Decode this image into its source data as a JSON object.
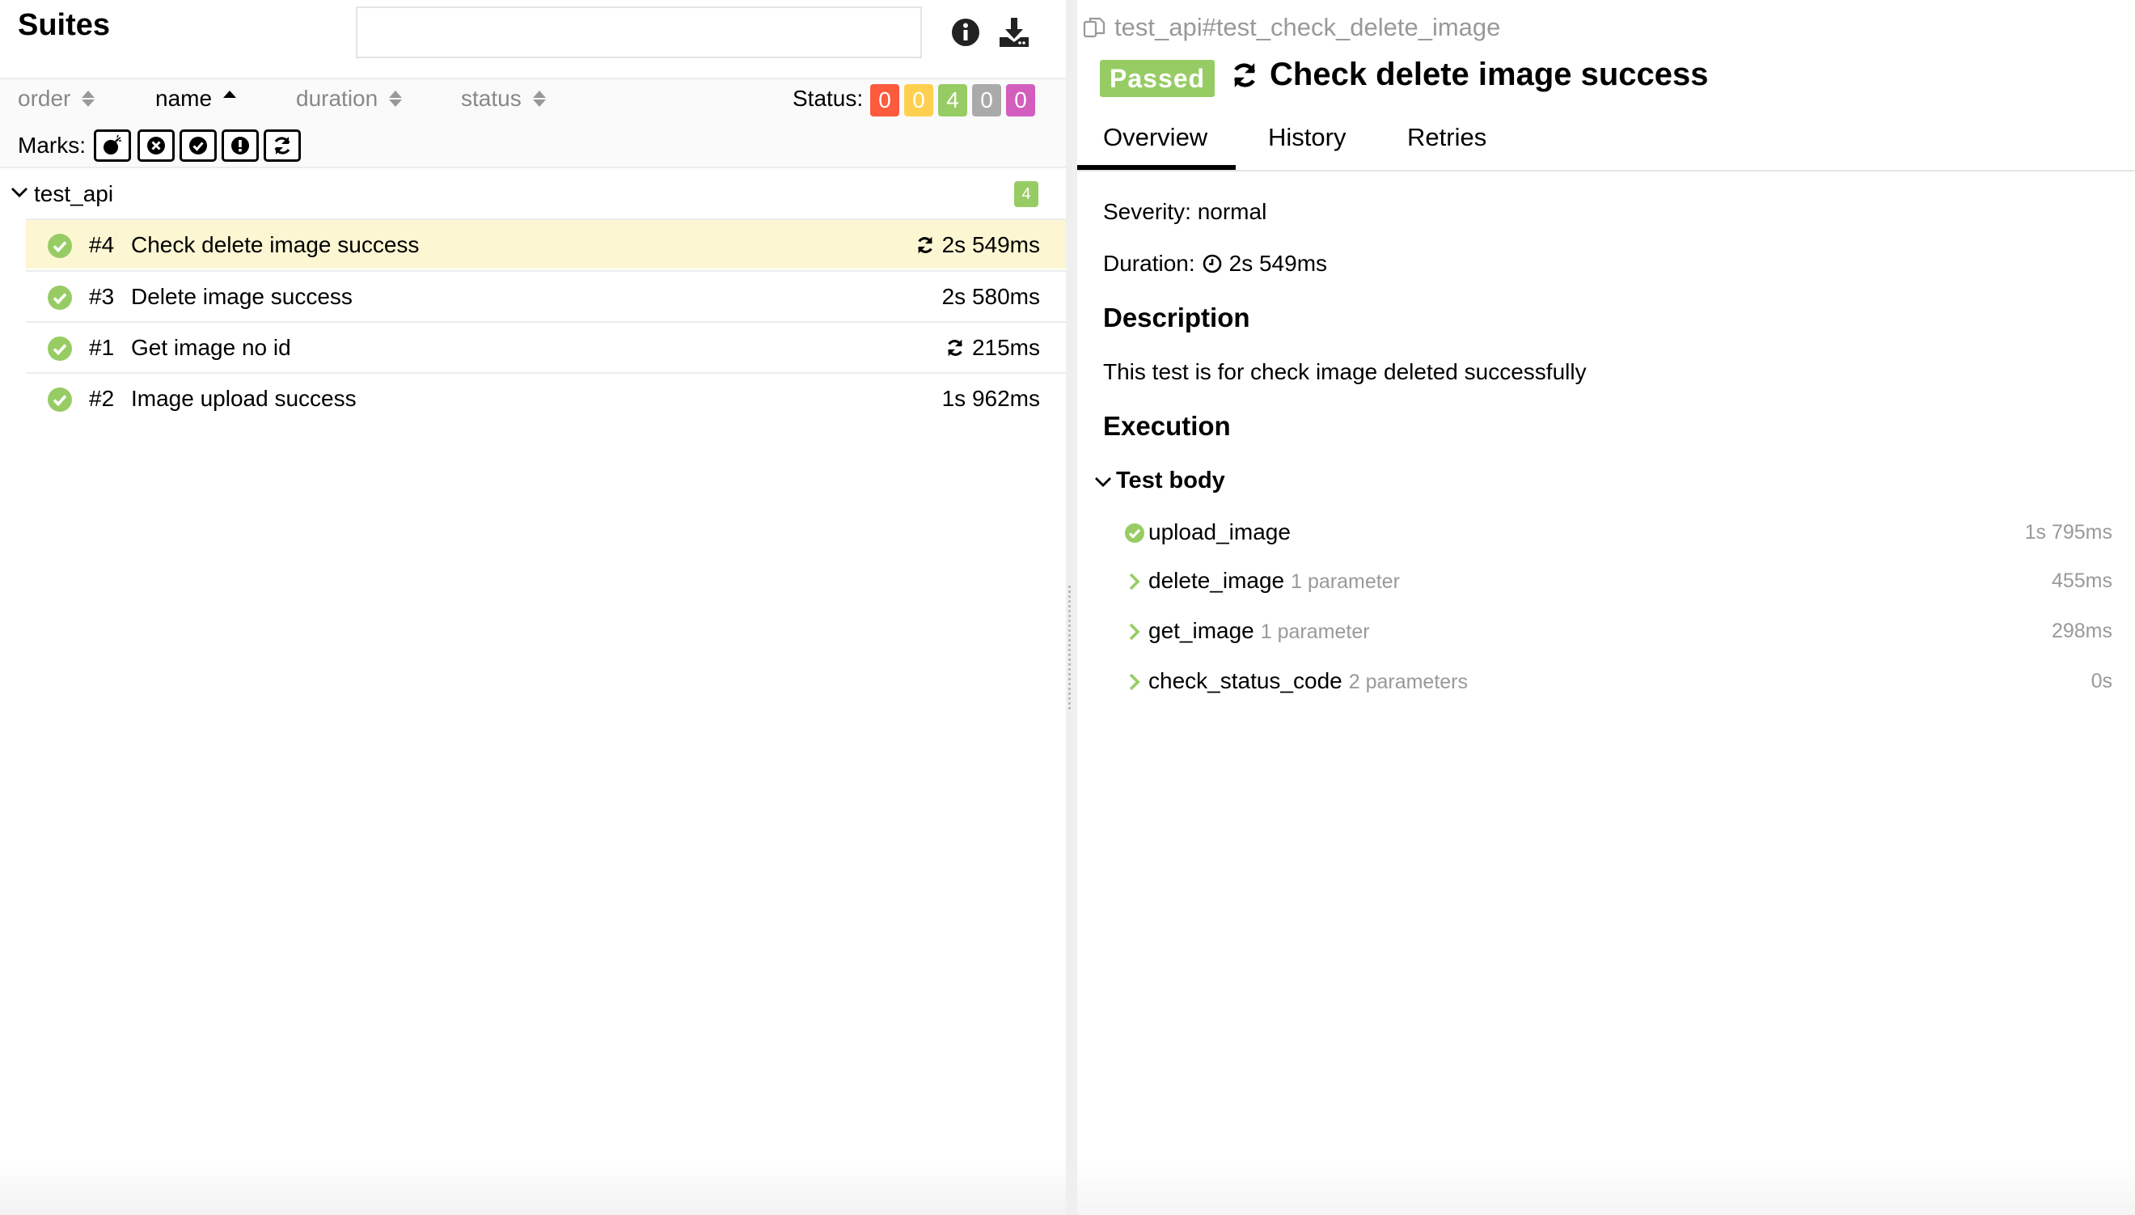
{
  "left": {
    "title": "Suites",
    "search": {
      "value": "",
      "placeholder": ""
    },
    "sorters": [
      {
        "label": "order",
        "active": false
      },
      {
        "label": "name",
        "active": true
      },
      {
        "label": "duration",
        "active": false
      },
      {
        "label": "status",
        "active": false
      }
    ],
    "status_label": "Status:",
    "status_counts": [
      {
        "name": "failed",
        "count": "0",
        "color": "#fd5a3e"
      },
      {
        "name": "broken",
        "count": "0",
        "color": "#ffd050"
      },
      {
        "name": "passed",
        "count": "4",
        "color": "#97cc64"
      },
      {
        "name": "skipped",
        "count": "0",
        "color": "#aaaaaa"
      },
      {
        "name": "unknown",
        "count": "0",
        "color": "#d35ebe"
      }
    ],
    "marks_label": "Marks:",
    "marks_icons": [
      "bomb-icon",
      "x-circle-icon",
      "check-circle-icon",
      "exclamation-circle-icon",
      "refresh-icon"
    ],
    "group": {
      "name": "test_api",
      "count": "4"
    },
    "rows": [
      {
        "num": "#4",
        "name": "Check delete image success",
        "duration": "2s 549ms",
        "retried": true,
        "selected": true
      },
      {
        "num": "#3",
        "name": "Delete image success",
        "duration": "2s 580ms",
        "retried": false,
        "selected": false
      },
      {
        "num": "#1",
        "name": "Get image no id",
        "duration": "215ms",
        "retried": true,
        "selected": false
      },
      {
        "num": "#2",
        "name": "Image upload success",
        "duration": "1s 962ms",
        "retried": false,
        "selected": false
      }
    ]
  },
  "right": {
    "uid": "test_api#test_check_delete_image",
    "status": "Passed",
    "title": "Check delete image success",
    "tabs": [
      "Overview",
      "History",
      "Retries"
    ],
    "active_tab": "Overview",
    "severity": "Severity: normal",
    "duration_label": "Duration:",
    "duration": "2s 549ms",
    "description_heading": "Description",
    "description": "This test is for check image deleted successfully",
    "execution_heading": "Execution",
    "test_body_label": "Test body",
    "steps": [
      {
        "name": "upload_image",
        "params": "",
        "duration": "1s 795ms",
        "state": "passed"
      },
      {
        "name": "delete_image",
        "params": "1 parameter",
        "duration": "455ms",
        "state": "collapsed"
      },
      {
        "name": "get_image",
        "params": "1 parameter",
        "duration": "298ms",
        "state": "collapsed"
      },
      {
        "name": "check_status_code",
        "params": "2 parameters",
        "duration": "0s",
        "state": "collapsed"
      }
    ]
  },
  "colors": {
    "passed": "#97cc64",
    "selected_row": "#fcf6d3"
  }
}
